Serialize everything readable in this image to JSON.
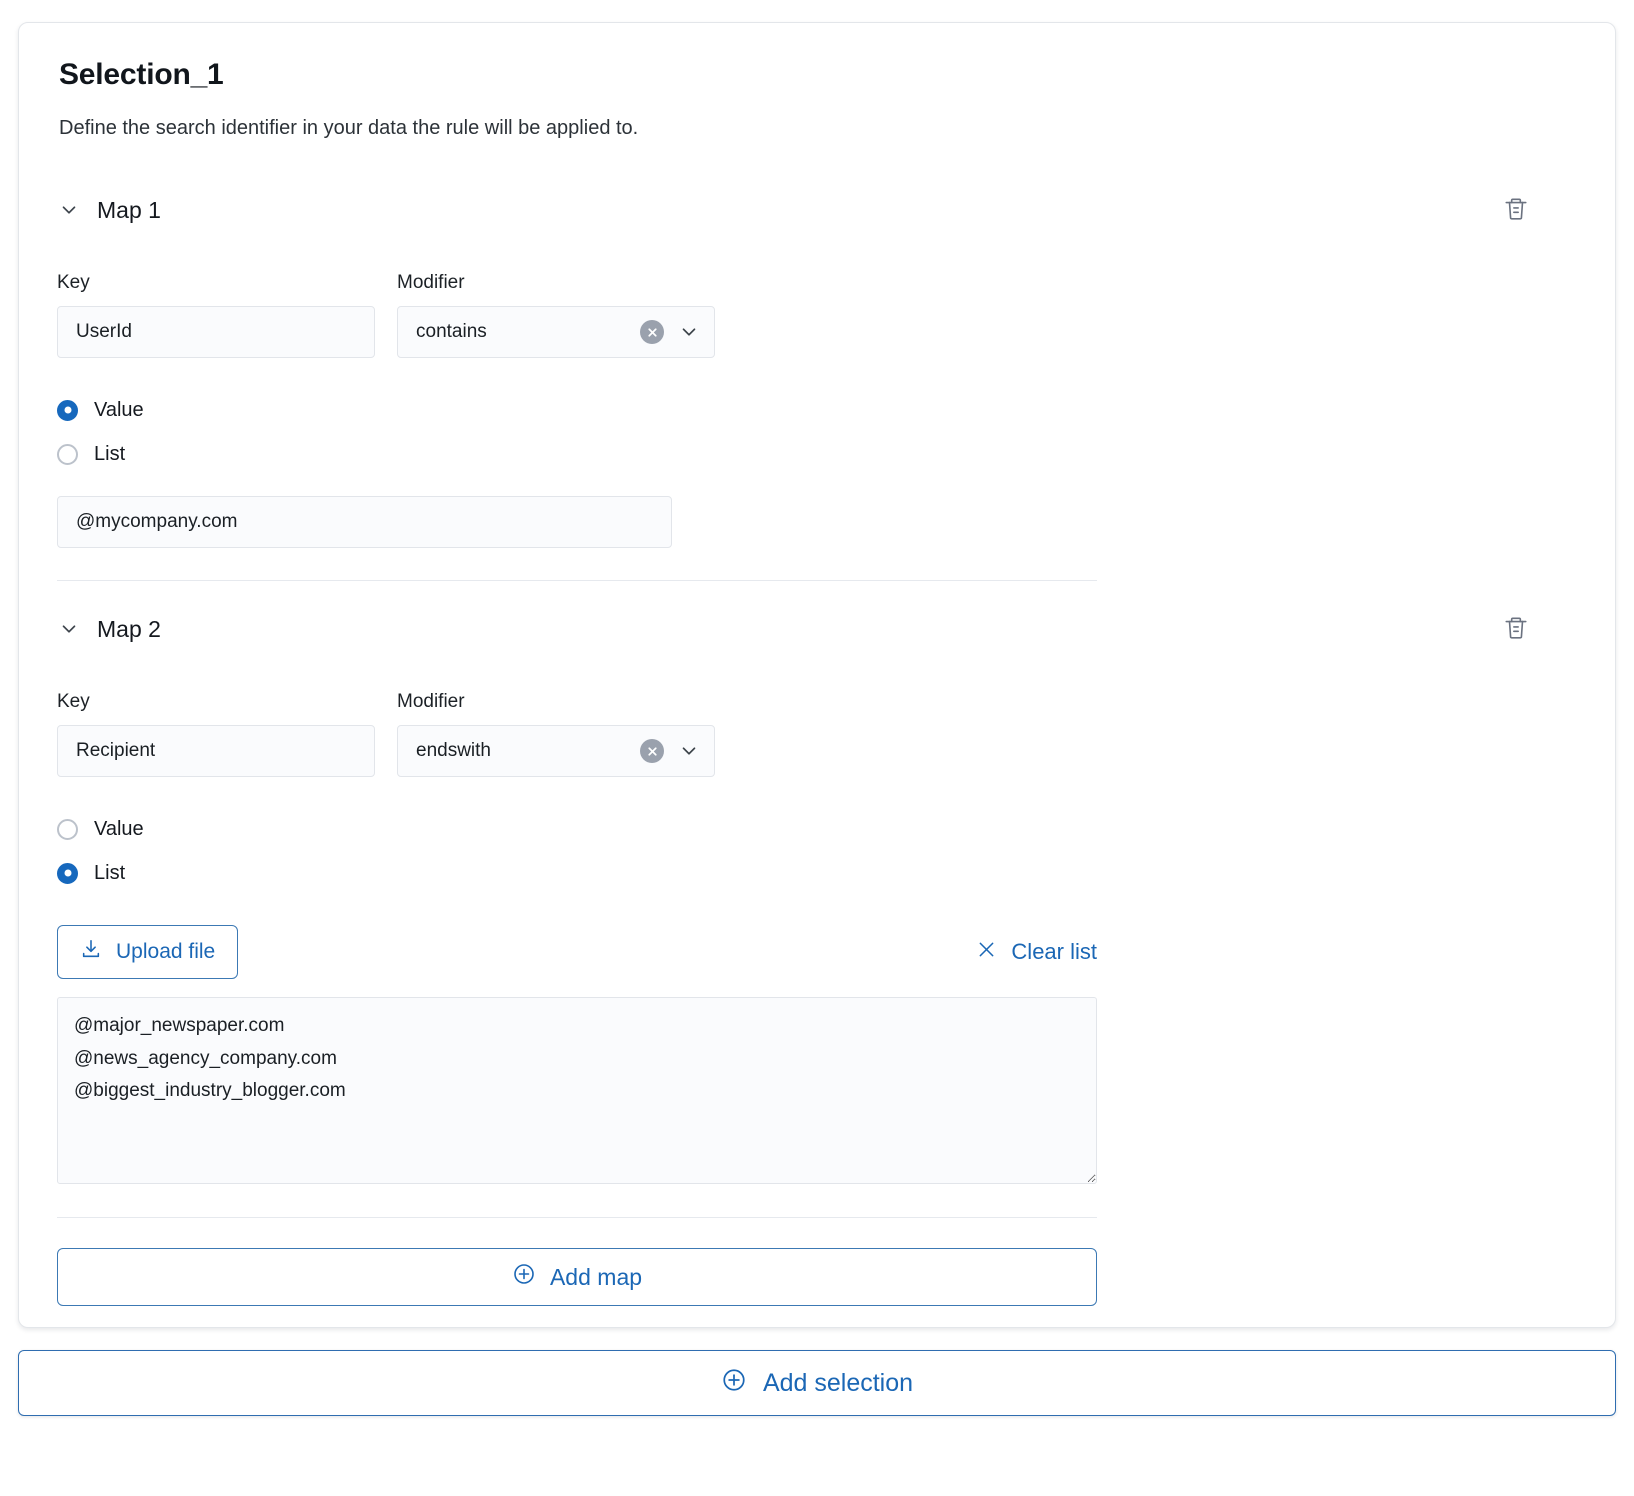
{
  "selection": {
    "title": "Selection_1",
    "subtitle": "Define the search identifier in your data the rule will be applied to."
  },
  "labels": {
    "key": "Key",
    "modifier": "Modifier",
    "value_radio": "Value",
    "list_radio": "List"
  },
  "maps": [
    {
      "name": "Map 1",
      "key_value": "UserId",
      "modifier_value": "contains",
      "mode": "value",
      "value_text": "@mycompany.com"
    },
    {
      "name": "Map 2",
      "key_value": "Recipient",
      "modifier_value": "endswith",
      "mode": "list",
      "upload_label": "Upload file",
      "clear_list_label": "Clear list",
      "list_text": "@major_newspaper.com\n@news_agency_company.com\n@biggest_industry_blogger.com"
    }
  ],
  "actions": {
    "add_map": "Add map",
    "add_selection": "Add selection"
  },
  "colors": {
    "accent": "#1b67b5",
    "radio_selected": "#1668bd",
    "input_bg": "#fafbfd",
    "border": "#e2e5ea"
  }
}
